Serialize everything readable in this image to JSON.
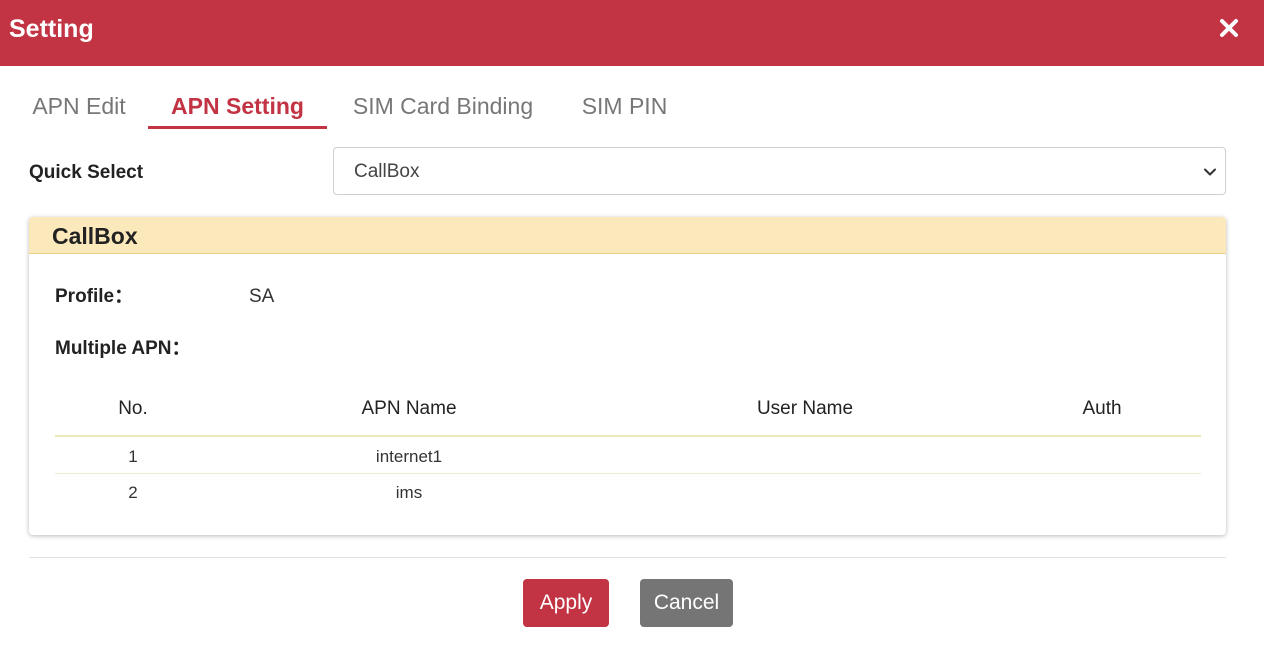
{
  "dialog": {
    "title": "Setting",
    "accent_color": "#c23343",
    "close_icon": "close-icon"
  },
  "tabs": [
    {
      "label": "APN Edit",
      "active": false
    },
    {
      "label": "APN Setting",
      "active": true
    },
    {
      "label": "SIM Card Binding",
      "active": false
    },
    {
      "label": "SIM PIN",
      "active": false
    }
  ],
  "quick_select": {
    "label": "Quick Select",
    "value": "CallBox",
    "icon": "chevron-down-icon"
  },
  "card": {
    "title": "CallBox",
    "profile_label": "Profile：",
    "profile_value": "SA",
    "multiple_apn_label": "Multiple APN：",
    "table": {
      "columns": [
        "No.",
        "APN Name",
        "User Name",
        "Auth"
      ],
      "rows": [
        [
          "1",
          "internet1",
          "",
          ""
        ],
        [
          "2",
          "ims",
          "",
          ""
        ]
      ]
    }
  },
  "buttons": {
    "apply": "Apply",
    "cancel": "Cancel",
    "apply_color": "#c23343",
    "cancel_color": "#757575"
  }
}
